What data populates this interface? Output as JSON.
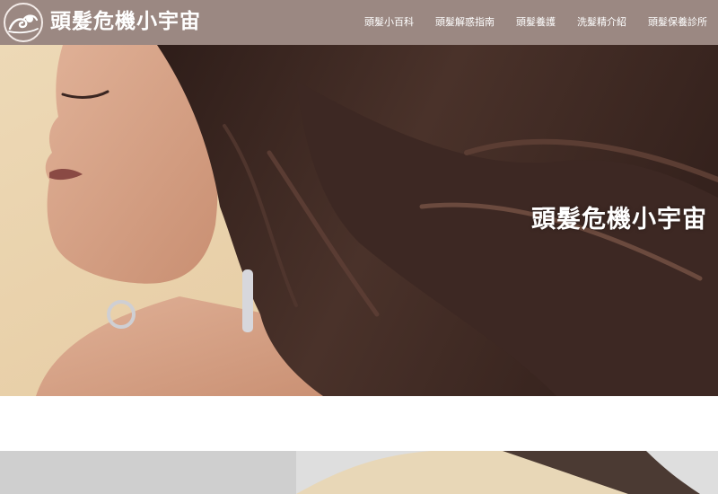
{
  "header": {
    "site_title": "頭髮危機小宇宙",
    "logo_icon": "hair-swirl-logo-icon",
    "nav": [
      {
        "label": "頭髮小百科"
      },
      {
        "label": "頭髮解惑指南"
      },
      {
        "label": "頭髮養護"
      },
      {
        "label": "洗髮精介紹"
      },
      {
        "label": "頭髮保養診所"
      }
    ]
  },
  "hero": {
    "title": "頭髮危機小宇宙"
  },
  "colors": {
    "header_bg": "#9b8882",
    "hero_bg": "#e9d3ae",
    "hair": "#3a2621",
    "skin": "#d9a488",
    "text": "#ffffff"
  }
}
